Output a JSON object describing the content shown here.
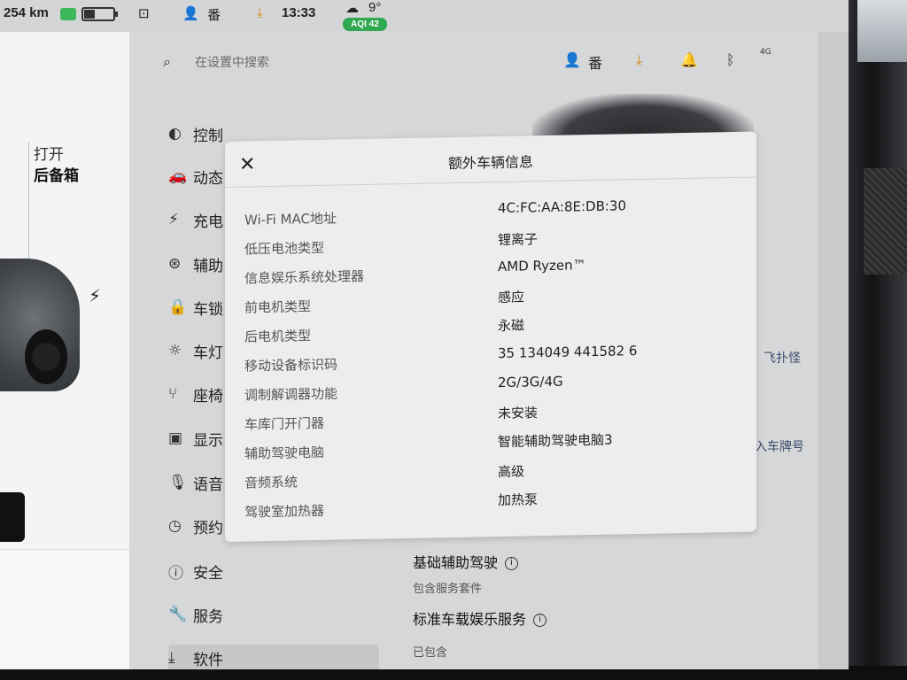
{
  "status_bar": {
    "range": "254 km",
    "profile_name": "番",
    "time": "13:33",
    "temperature": "9°",
    "aqi": "AQI 42"
  },
  "left_panel": {
    "trunk_action": "打开",
    "trunk_label": "后备箱"
  },
  "search": {
    "placeholder": "在设置中搜索"
  },
  "header": {
    "profile_name": "番",
    "cell_signal": "4G"
  },
  "sidebar": {
    "items": [
      {
        "label": "控制",
        "icon": "toggle-icon"
      },
      {
        "label": "动态",
        "icon": "car-icon"
      },
      {
        "label": "充电",
        "icon": "bolt-icon"
      },
      {
        "label": "辅助",
        "icon": "steering-wheel-icon"
      },
      {
        "label": "车锁",
        "icon": "lock-icon"
      },
      {
        "label": "车灯",
        "icon": "sun-icon"
      },
      {
        "label": "座椅",
        "icon": "seat-icon"
      },
      {
        "label": "显示",
        "icon": "display-icon"
      },
      {
        "label": "语音",
        "icon": "mic-icon"
      },
      {
        "label": "预约",
        "icon": "clock-icon"
      },
      {
        "label": "安全",
        "icon": "info-circle-icon"
      },
      {
        "label": "服务",
        "icon": "wrench-icon"
      },
      {
        "label": "软件",
        "icon": "download-icon"
      }
    ]
  },
  "content": {
    "items": [
      {
        "title": "基础辅助驾驶",
        "subtitle": "包含服务套件"
      },
      {
        "title": "标准车载娱乐服务",
        "subtitle": "已包含"
      }
    ],
    "right_partial_texts": [
      "飞扑怪",
      "入车牌号"
    ]
  },
  "modal": {
    "title": "额外车辆信息",
    "rows": [
      {
        "label": "Wi-Fi MAC地址",
        "value": "4C:FC:AA:8E:DB:30"
      },
      {
        "label": "低压电池类型",
        "value": "锂离子"
      },
      {
        "label": "信息娱乐系统处理器",
        "value": "AMD Ryzen™"
      },
      {
        "label": "前电机类型",
        "value": "感应"
      },
      {
        "label": "后电机类型",
        "value": "永磁"
      },
      {
        "label": "移动设备标识码",
        "value": "35 134049 441582 6"
      },
      {
        "label": "调制解调器功能",
        "value": "2G/3G/4G"
      },
      {
        "label": "车库门开门器",
        "value": "未安装"
      },
      {
        "label": "辅助驾驶电脑",
        "value": "智能辅助驾驶电脑3"
      },
      {
        "label": "音频系统",
        "value": "高级"
      },
      {
        "label": "驾驶室加热器",
        "value": "加热泵"
      }
    ]
  },
  "colors": {
    "aqi_badge": "#2fa84f",
    "modal_background": "#ededed",
    "settings_background": "#d6d7d9"
  }
}
